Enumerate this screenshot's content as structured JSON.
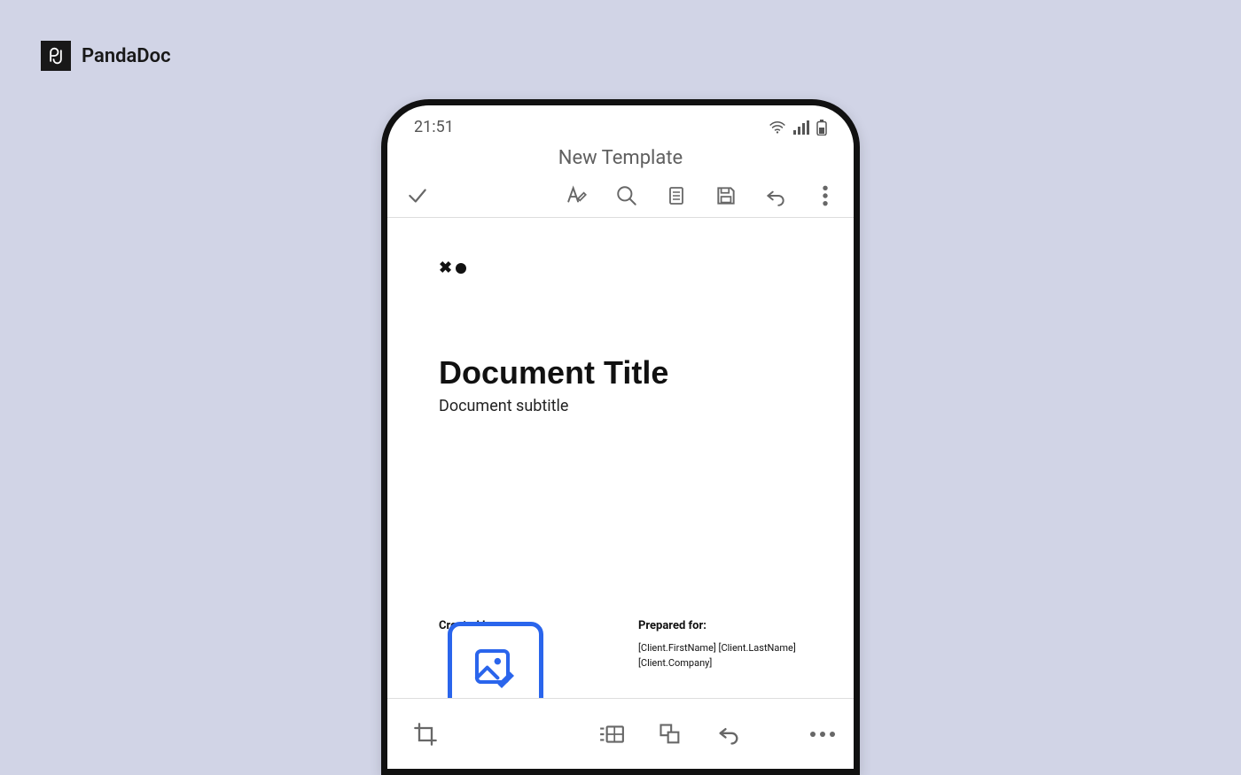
{
  "brand": {
    "name": "PandaDoc",
    "mark": "pd"
  },
  "status": {
    "time": "21:51"
  },
  "page": {
    "title": "New Template"
  },
  "toolbar": {
    "confirm": "confirm",
    "style": "text-style",
    "search": "search",
    "reader": "reading-view",
    "save": "save",
    "undo": "undo",
    "more": "more"
  },
  "document": {
    "title": "Document Title",
    "subtitle": "Document subtitle",
    "created_by_label": "Created by:",
    "prepared_for_label": "Prepared for:",
    "prepared_line1": "[Client.FirstName] [Client.LastName]",
    "prepared_line2": "[Client.Company]"
  },
  "bottombar": {
    "crop": "crop",
    "image_edit": "image-edit",
    "table": "insert-table",
    "shapes": "shapes",
    "undo": "undo",
    "more": "more"
  },
  "colors": {
    "accent": "#2a65ec"
  }
}
